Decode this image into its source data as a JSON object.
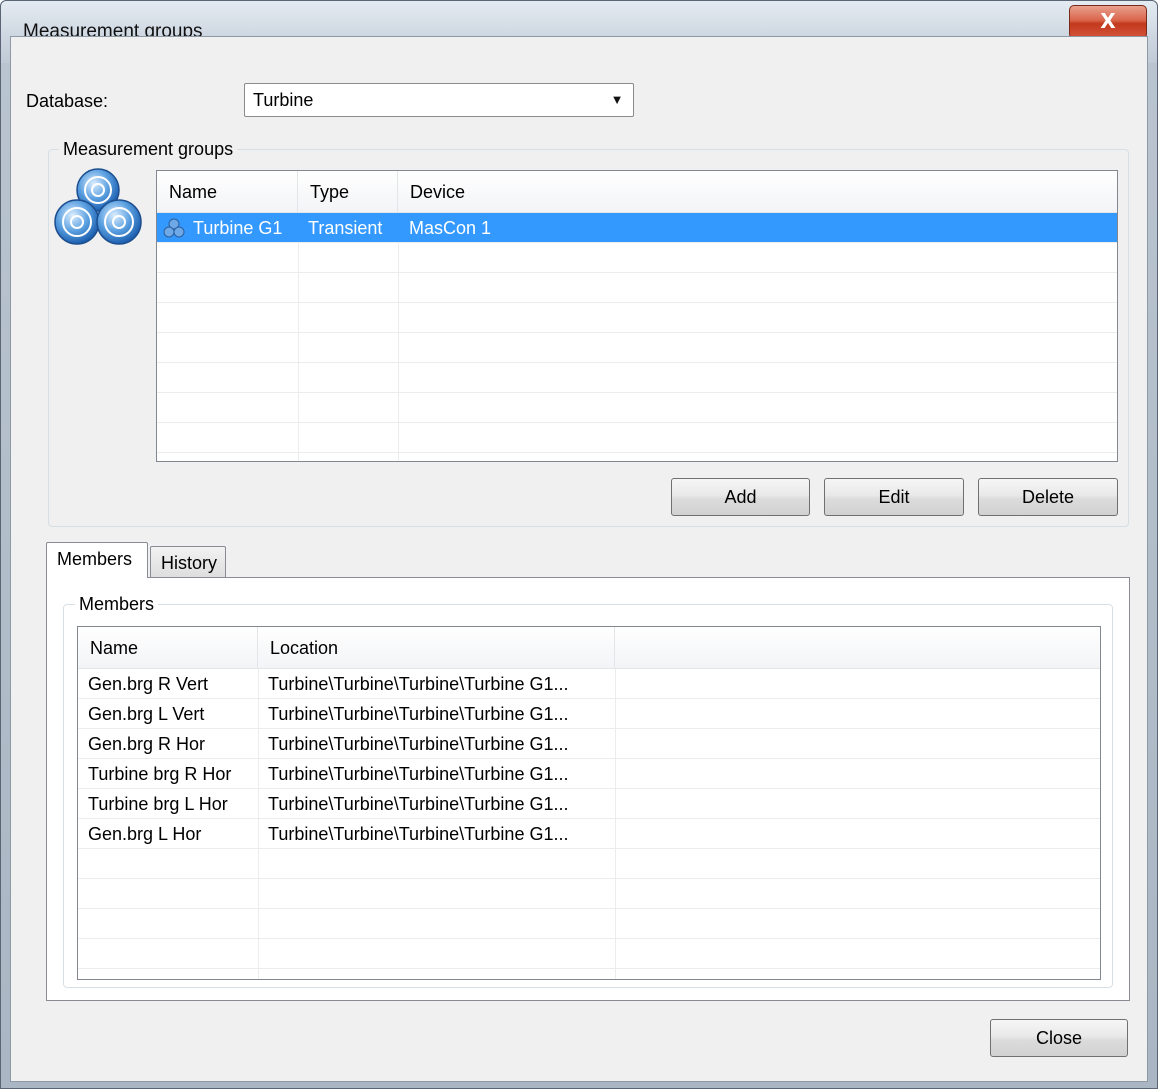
{
  "window": {
    "title": "Measurement groups",
    "close_label": "X"
  },
  "database": {
    "label": "Database:",
    "value": "Turbine"
  },
  "groups_box": {
    "legend": "Measurement groups",
    "columns": [
      "Name",
      "Type",
      "Device"
    ],
    "rows": [
      {
        "name": "Turbine G1",
        "type": "Transient",
        "device": "MasCon 1",
        "selected": true
      }
    ],
    "buttons": {
      "add": "Add",
      "edit": "Edit",
      "delete": "Delete"
    }
  },
  "tabs": [
    {
      "label": "Members",
      "active": true
    },
    {
      "label": "History",
      "active": false
    }
  ],
  "members_box": {
    "legend": "Members",
    "columns": [
      "Name",
      "Location"
    ],
    "rows": [
      {
        "name": "Gen.brg R Vert",
        "location": "Turbine\\Turbine\\Turbine\\Turbine G1..."
      },
      {
        "name": "Gen.brg L Vert",
        "location": "Turbine\\Turbine\\Turbine\\Turbine G1..."
      },
      {
        "name": "Gen.brg R Hor",
        "location": "Turbine\\Turbine\\Turbine\\Turbine G1..."
      },
      {
        "name": "Turbine brg R Hor",
        "location": "Turbine\\Turbine\\Turbine\\Turbine G1..."
      },
      {
        "name": "Turbine brg L Hor",
        "location": "Turbine\\Turbine\\Turbine\\Turbine G1..."
      },
      {
        "name": "Gen.brg L Hor",
        "location": "Turbine\\Turbine\\Turbine\\Turbine G1..."
      }
    ]
  },
  "footer": {
    "close": "Close"
  },
  "icons": {
    "groups_icon": "measurement-groups-icon",
    "row_icon": "group-icon",
    "dropdown": "chevron-down-icon"
  },
  "colors": {
    "selection": "#3399ff",
    "close_button": "#c2391d"
  }
}
